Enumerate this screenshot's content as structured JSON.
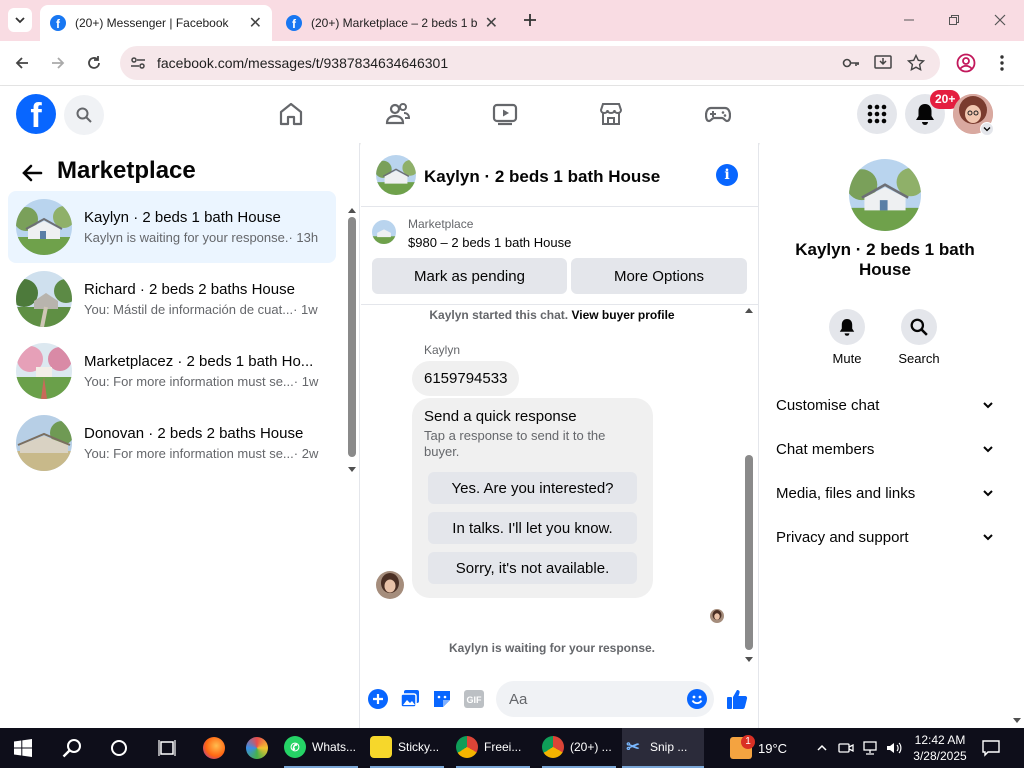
{
  "browser": {
    "tabs": [
      {
        "title": "(20+) Messenger | Facebook",
        "active": true
      },
      {
        "title": "(20+) Marketplace – 2 beds 1 b",
        "active": false
      }
    ],
    "url": "facebook.com/messages/t/9387834634646301"
  },
  "fbnav": {
    "notifications_badge": "20+",
    "icons": [
      "home-icon",
      "friends-icon",
      "video-icon",
      "marketplace-icon",
      "gaming-icon",
      "menu-grid-icon",
      "bell-icon"
    ]
  },
  "left": {
    "title": "Marketplace",
    "conversations": [
      {
        "name": "Kaylyn · 2 beds 1 bath House",
        "preview": "Kaylyn is waiting for your response.",
        "time": " · 13h",
        "selected": true
      },
      {
        "name": "Richard · 2 beds 2 baths House",
        "preview": "You: Mástil de información de cuat...",
        "time": " · 1w",
        "selected": false
      },
      {
        "name": "Marketplacez · 2 beds 1 bath Ho...",
        "preview": "You: For more information must se...",
        "time": " · 1w",
        "selected": false
      },
      {
        "name": "Donovan · 2 beds 2 baths House",
        "preview": "You: For more information must se...",
        "time": " · 2w",
        "selected": false
      }
    ]
  },
  "chat": {
    "header_name": "Kaylyn · 2 beds 1 bath House",
    "listing_label": "Marketplace",
    "listing_price": "$980 – 2 beds 1 bath House",
    "btn_pending": "Mark as pending",
    "btn_more": "More Options",
    "started_prefix": "Kaylyn started this chat.",
    "started_link": "View buyer profile",
    "sender": "Kaylyn",
    "phone": "6159794533",
    "quick_title": "Send a quick response",
    "quick_sub": "Tap a response to send it to the buyer.",
    "quick_options": [
      "Yes. Are you interested?",
      "In talks. I'll let you know.",
      "Sorry, it's not available."
    ],
    "waiting": "Kaylyn is waiting for your response.",
    "input_placeholder": "Aa"
  },
  "right": {
    "name": "Kaylyn · 2 beds 1 bath House",
    "actions": [
      {
        "label": "Mute"
      },
      {
        "label": "Search"
      }
    ],
    "sections": [
      "Customise chat",
      "Chat members",
      "Media, files and links",
      "Privacy and support"
    ]
  },
  "taskbar": {
    "apps": [
      "Whats...",
      "Sticky...",
      "Freei...",
      "(20+) ...",
      "Snip ..."
    ],
    "weather": "19°C",
    "weather_badge": "1",
    "time": "12:42 AM",
    "date": "3/28/2025"
  },
  "colors": {
    "fb_blue": "#0866ff",
    "selected_row": "#ebf5ff",
    "tab_strip": "#f9dce3",
    "taskbar": "#0e0e1a"
  }
}
